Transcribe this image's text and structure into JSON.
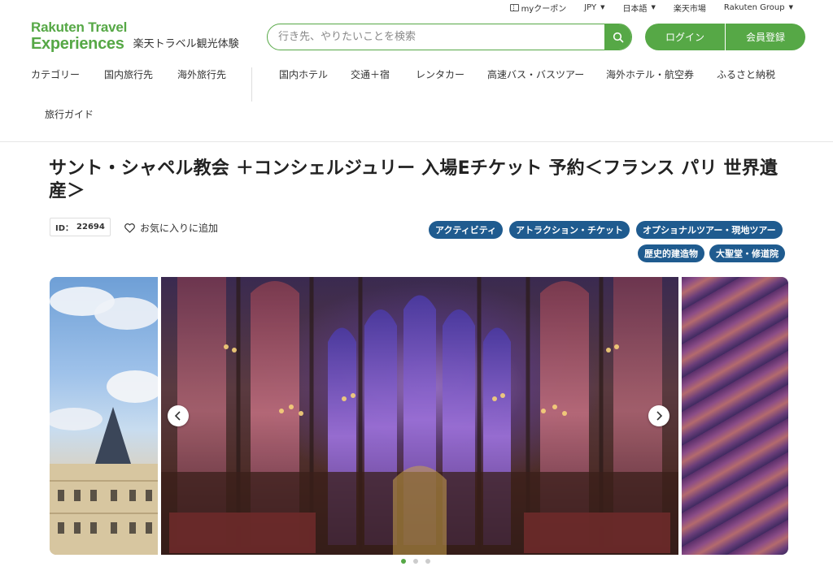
{
  "utility_bar": {
    "coupon": "myクーポン",
    "currency": "JPY",
    "language": "日本語",
    "market": "楽天市場",
    "group": "Rakuten Group"
  },
  "logo": {
    "line1": "Rakuten Travel",
    "line2": "Experiences",
    "subtitle": "楽天トラベル観光体験"
  },
  "search": {
    "placeholder": "行き先、やりたいことを検索"
  },
  "auth": {
    "login": "ログイン",
    "register": "会員登録"
  },
  "nav": {
    "items": [
      "カテゴリー",
      "国内旅行先",
      "海外旅行先",
      "国内ホテル",
      "交通＋宿",
      "レンタカー",
      "高速バス・バスツアー",
      "海外ホテル・航空券",
      "ふるさと納税",
      "旅行ガイド"
    ]
  },
  "product": {
    "title": "サント・シャペル教会 ＋コンシェルジュリー 入場Eチケット 予約＜フランス パリ 世界遺産＞",
    "id_label": "ID：",
    "id_value": "22694",
    "favorite": "お気に入りに追加",
    "tags": [
      "アクティビティ",
      "アトラクション・チケット",
      "オプショナルツアー・現地ツアー",
      "歴史的建造物",
      "大聖堂・修道院"
    ]
  },
  "gallery": {
    "slide_count": 3,
    "active_slide": 1
  },
  "colors": {
    "brand_green": "#56a846",
    "tag_blue": "#1f5b8f"
  }
}
